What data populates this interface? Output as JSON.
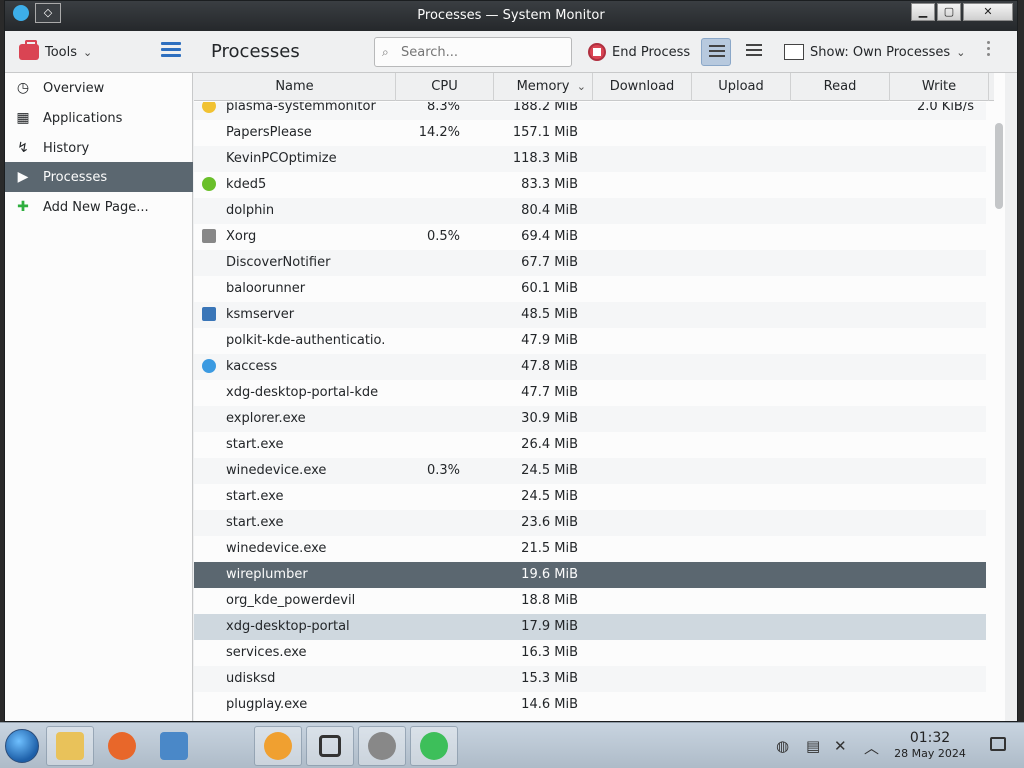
{
  "window": {
    "title": "Processes — System Monitor",
    "pin_glyph": "◇",
    "min_glyph": "▁",
    "max_glyph": "▢",
    "close_glyph": "✕"
  },
  "toolbar": {
    "tools_label": "Tools",
    "page_title": "Processes",
    "search_placeholder": "Search...",
    "end_process_label": "End Process",
    "show_label": "Show: Own Processes",
    "chevron": "⌄"
  },
  "sidebar": {
    "items": [
      {
        "label": "Overview",
        "icon": "gauge-icon",
        "glyph": "◷"
      },
      {
        "label": "Applications",
        "icon": "apps-grid-icon",
        "glyph": "▦"
      },
      {
        "label": "History",
        "icon": "chart-icon",
        "glyph": "↯"
      },
      {
        "label": "Processes",
        "icon": "play-icon",
        "glyph": "▶",
        "active": true
      },
      {
        "label": "Add New Page...",
        "icon": "plus-icon",
        "glyph": "✚"
      }
    ]
  },
  "table": {
    "columns": [
      "Name",
      "CPU",
      "Memory",
      "Download",
      "Upload",
      "Read",
      "Write"
    ],
    "rows": [
      {
        "name": "plasma-systemmonitor",
        "cpu": "8.3%",
        "mem": "188.2 MiB",
        "write": "2.0 KiB/s",
        "icon_color": "#f1c232",
        "partial": true
      },
      {
        "name": "PapersPlease",
        "cpu": "14.2%",
        "mem": "157.1 MiB"
      },
      {
        "name": "KevinPCOptimize",
        "cpu": "",
        "mem": "118.3 MiB"
      },
      {
        "name": "kded5",
        "cpu": "",
        "mem": "83.3 MiB",
        "icon_color": "#6abf2a"
      },
      {
        "name": "dolphin",
        "cpu": "",
        "mem": "80.4 MiB"
      },
      {
        "name": "Xorg",
        "cpu": "0.5%",
        "mem": "69.4 MiB",
        "icon_color": "#888888"
      },
      {
        "name": "DiscoverNotifier",
        "cpu": "",
        "mem": "67.7 MiB"
      },
      {
        "name": "baloorunner",
        "cpu": "",
        "mem": "60.1 MiB"
      },
      {
        "name": "ksmserver",
        "cpu": "",
        "mem": "48.5 MiB",
        "icon_color": "#3a76b8"
      },
      {
        "name": "polkit-kde-authenticatio...",
        "cpu": "",
        "mem": "47.9 MiB"
      },
      {
        "name": "kaccess",
        "cpu": "",
        "mem": "47.8 MiB",
        "icon_color": "#3b9ae1"
      },
      {
        "name": "xdg-desktop-portal-kde",
        "cpu": "",
        "mem": "47.7 MiB"
      },
      {
        "name": "explorer.exe",
        "cpu": "",
        "mem": "30.9 MiB"
      },
      {
        "name": "start.exe",
        "cpu": "",
        "mem": "26.4 MiB"
      },
      {
        "name": "winedevice.exe",
        "cpu": "0.3%",
        "mem": "24.5 MiB"
      },
      {
        "name": "start.exe",
        "cpu": "",
        "mem": "24.5 MiB"
      },
      {
        "name": "start.exe",
        "cpu": "",
        "mem": "23.6 MiB"
      },
      {
        "name": "winedevice.exe",
        "cpu": "",
        "mem": "21.5 MiB"
      },
      {
        "name": "wireplumber",
        "cpu": "",
        "mem": "19.6 MiB",
        "selected": true
      },
      {
        "name": "org_kde_powerdevil",
        "cpu": "",
        "mem": "18.8 MiB"
      },
      {
        "name": "xdg-desktop-portal",
        "cpu": "",
        "mem": "17.9 MiB",
        "hover": true
      },
      {
        "name": "services.exe",
        "cpu": "",
        "mem": "16.3 MiB"
      },
      {
        "name": "udisksd",
        "cpu": "",
        "mem": "15.3 MiB"
      },
      {
        "name": "plugplay.exe",
        "cpu": "",
        "mem": "14.6 MiB"
      }
    ]
  },
  "taskbar": {
    "apps": [
      {
        "name": "file-manager-icon",
        "color": "#e9c25a",
        "open": true
      },
      {
        "name": "firefox-icon",
        "color": "#e8672a"
      },
      {
        "name": "system-settings-icon",
        "color": "#4a88c8"
      },
      {
        "name": "x-icon",
        "color": "#dcdcdc"
      },
      {
        "name": "sun-icon",
        "color": "#f0a030",
        "open": true
      },
      {
        "name": "windows-stack-icon",
        "color": "#ffffff",
        "open": true
      },
      {
        "name": "compass-icon",
        "color": "#888888",
        "open": true
      },
      {
        "name": "tools-app-icon",
        "color": "#3dbf5a",
        "open": true
      }
    ],
    "time": "01:32",
    "date": "28 May 2024"
  },
  "colors": {
    "accent": "#5b6770",
    "hover": "#cfd8df",
    "end_process": "#da4453"
  }
}
